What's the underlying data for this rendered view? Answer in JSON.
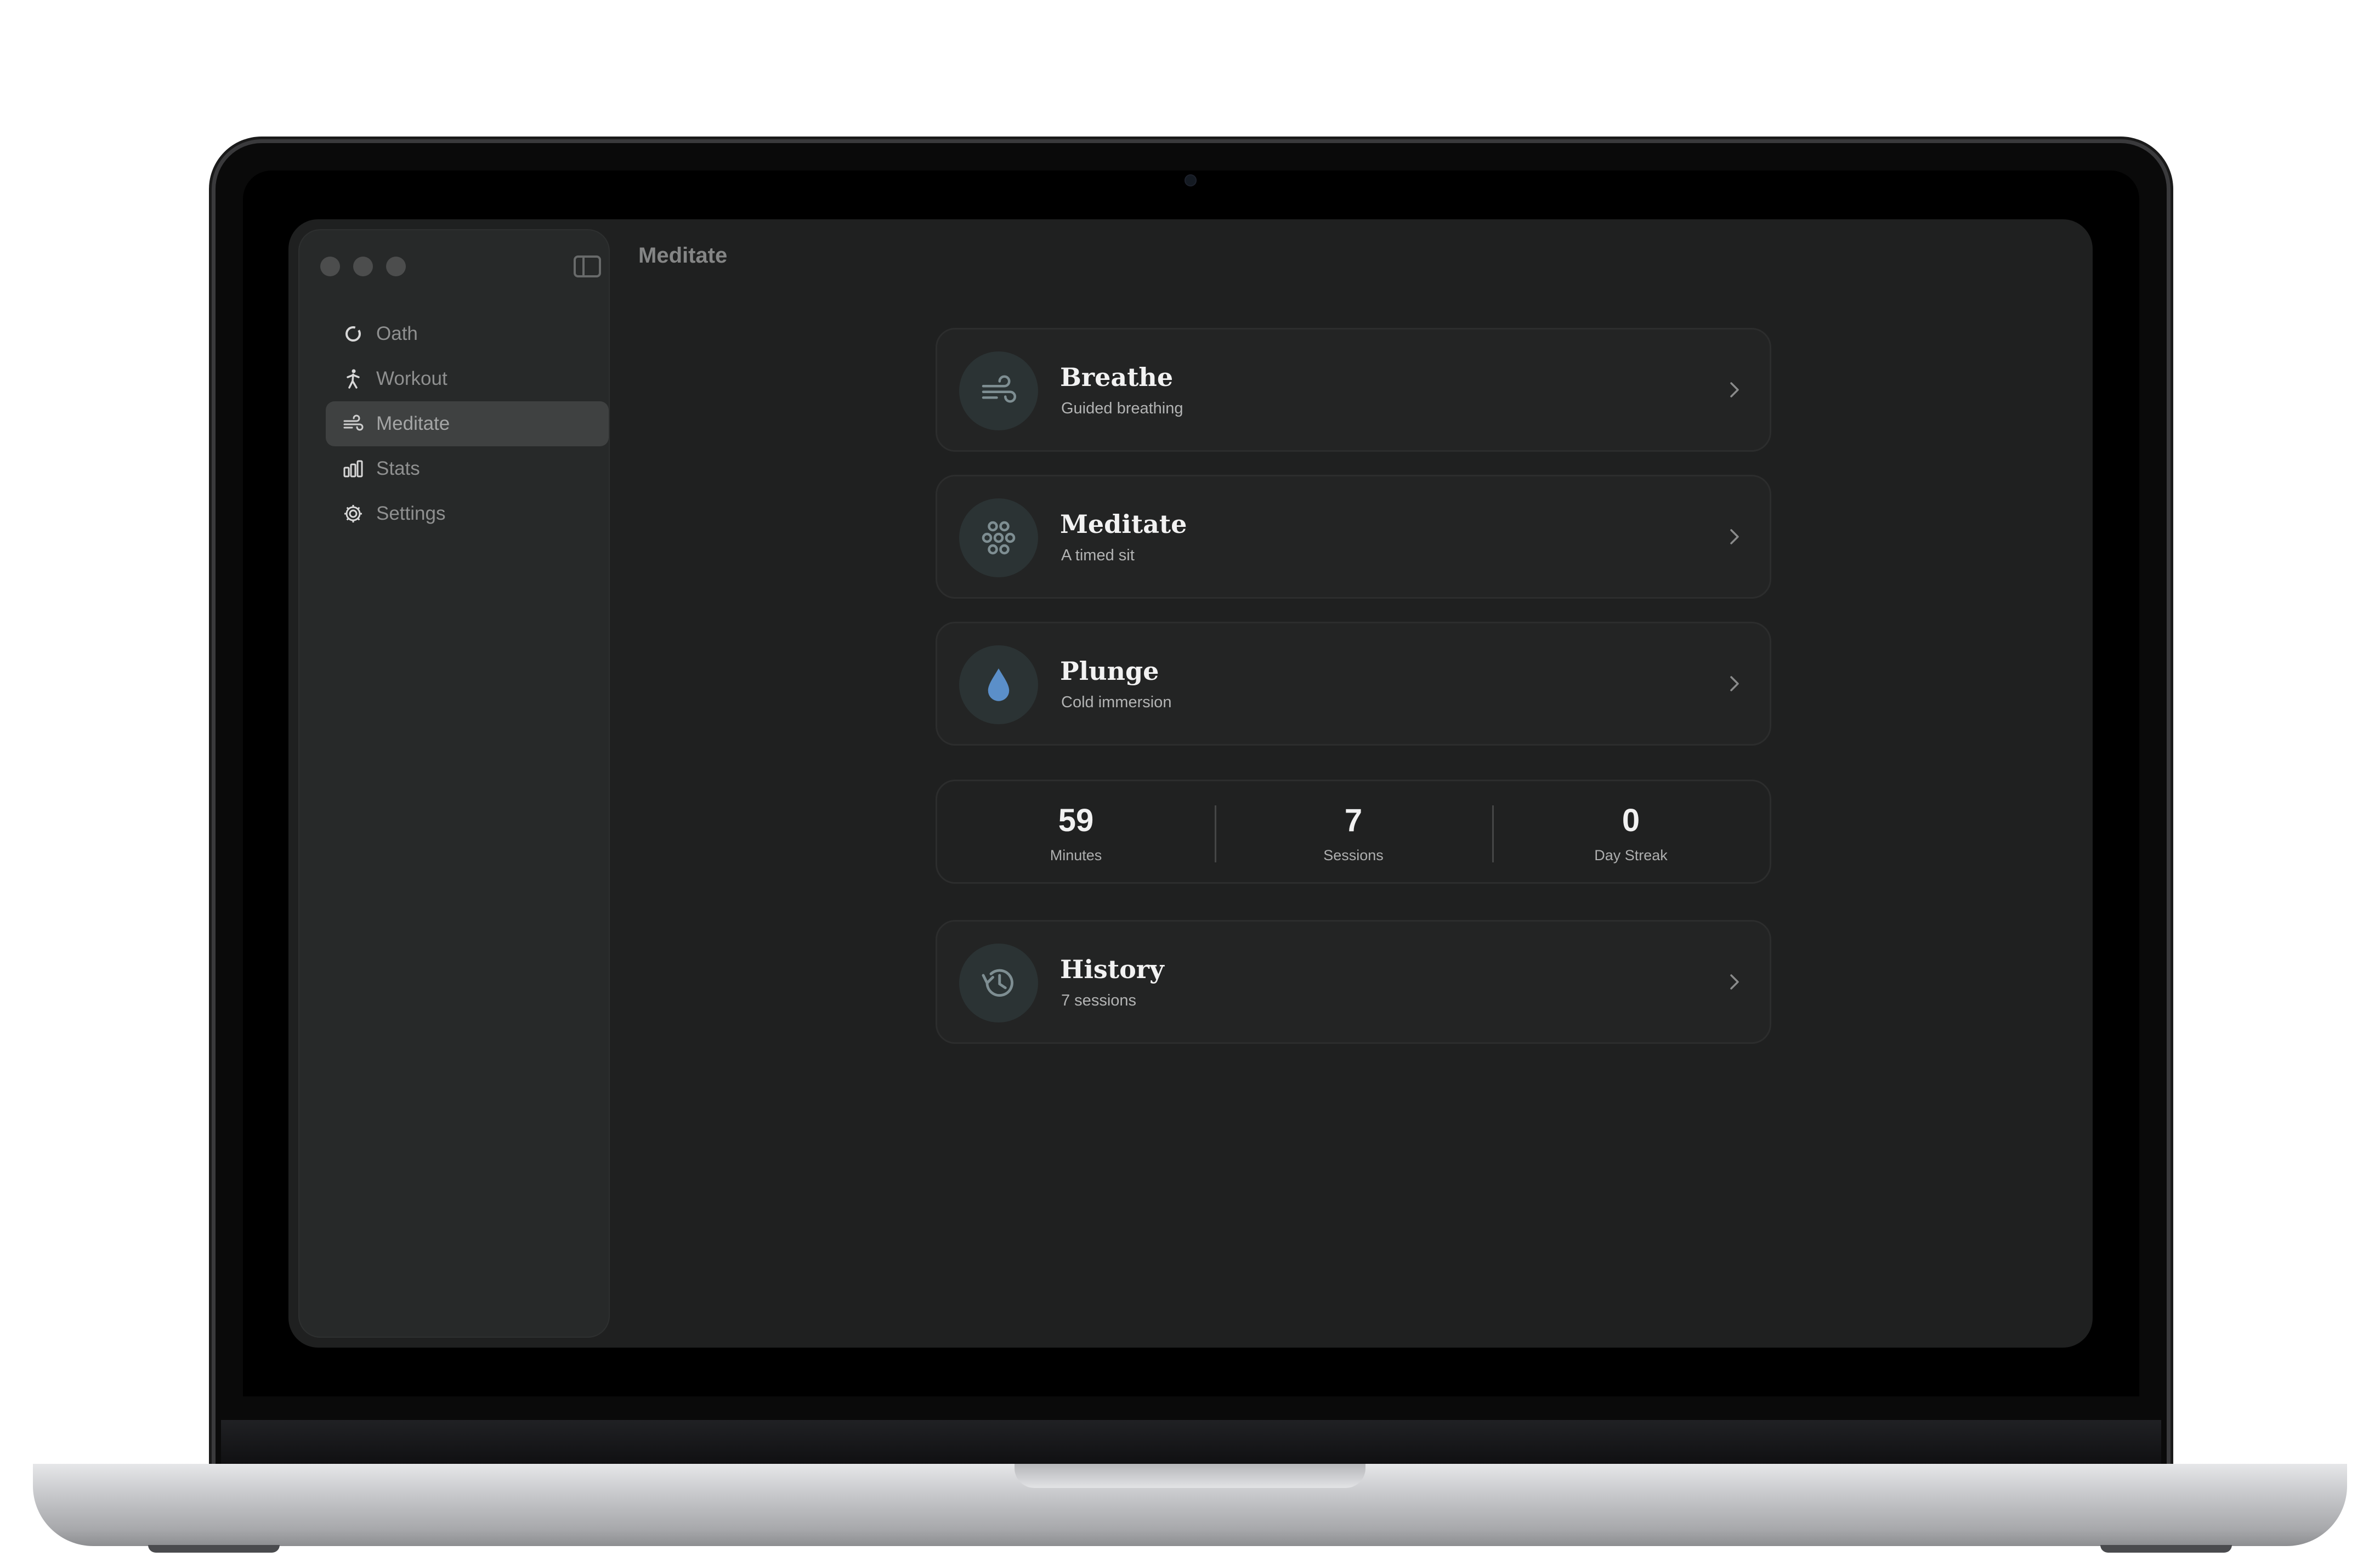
{
  "window": {
    "title": "Meditate"
  },
  "sidebar": {
    "items": [
      {
        "label": "Oath",
        "icon": "ring-icon",
        "active": false
      },
      {
        "label": "Workout",
        "icon": "figure-icon",
        "active": false
      },
      {
        "label": "Meditate",
        "icon": "wind-icon",
        "active": true
      },
      {
        "label": "Stats",
        "icon": "bars-icon",
        "active": false
      },
      {
        "label": "Settings",
        "icon": "gear-icon",
        "active": false
      }
    ]
  },
  "cards": [
    {
      "title": "Breathe",
      "subtitle": "Guided breathing",
      "icon": "wind-icon"
    },
    {
      "title": "Meditate",
      "subtitle": "A timed sit",
      "icon": "dots-flower-icon"
    },
    {
      "title": "Plunge",
      "subtitle": "Cold immersion",
      "icon": "water-drop-icon"
    }
  ],
  "stats": [
    {
      "value": "59",
      "label": "Minutes"
    },
    {
      "value": "7",
      "label": "Sessions"
    },
    {
      "value": "0",
      "label": "Day Streak"
    }
  ],
  "history": {
    "title": "History",
    "subtitle": "7 sessions",
    "icon": "history-clock-icon"
  },
  "colors": {
    "accent_drop": "#5b8fc9",
    "icon_stroke": "#7e8e92",
    "background": "#1f2020"
  }
}
